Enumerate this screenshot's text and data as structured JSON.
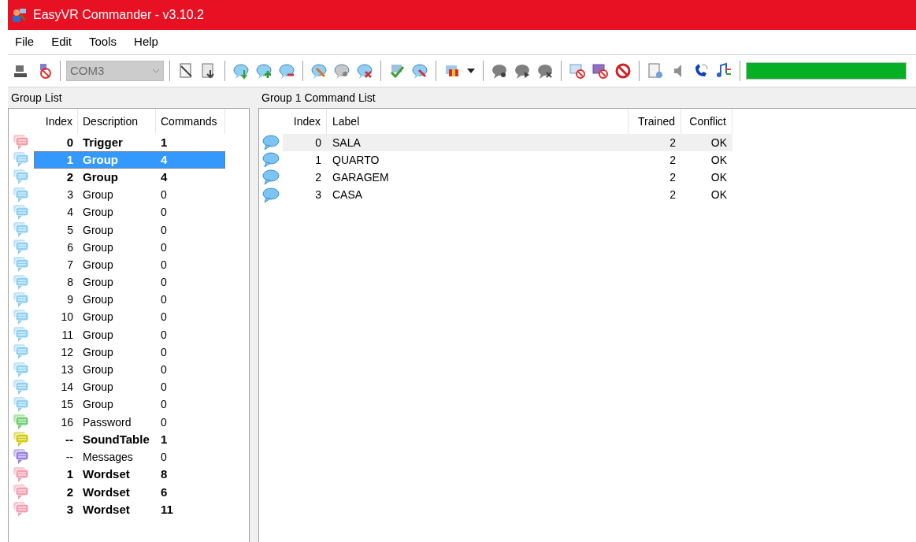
{
  "window": {
    "title": "EasyVR Commander - v3.10.2"
  },
  "menu": [
    "File",
    "Edit",
    "Tools",
    "Help"
  ],
  "toolbar": {
    "port": {
      "value": "COM3",
      "disabled": true
    },
    "status": {
      "level": 1
    }
  },
  "group_list": {
    "title": "Group List",
    "columns": [
      "Index",
      "Description",
      "Commands"
    ],
    "rows": [
      {
        "kind": "trigger",
        "index": "0",
        "description": "Trigger",
        "commands": "1",
        "bold": true,
        "selected": false
      },
      {
        "kind": "group",
        "index": "1",
        "description": "Group",
        "commands": "4",
        "bold": true,
        "selected": true
      },
      {
        "kind": "group",
        "index": "2",
        "description": "Group",
        "commands": "4",
        "bold": true,
        "selected": false
      },
      {
        "kind": "group",
        "index": "3",
        "description": "Group",
        "commands": "0",
        "bold": false,
        "selected": false
      },
      {
        "kind": "group",
        "index": "4",
        "description": "Group",
        "commands": "0",
        "bold": false,
        "selected": false
      },
      {
        "kind": "group",
        "index": "5",
        "description": "Group",
        "commands": "0",
        "bold": false,
        "selected": false
      },
      {
        "kind": "group",
        "index": "6",
        "description": "Group",
        "commands": "0",
        "bold": false,
        "selected": false
      },
      {
        "kind": "group",
        "index": "7",
        "description": "Group",
        "commands": "0",
        "bold": false,
        "selected": false
      },
      {
        "kind": "group",
        "index": "8",
        "description": "Group",
        "commands": "0",
        "bold": false,
        "selected": false
      },
      {
        "kind": "group",
        "index": "9",
        "description": "Group",
        "commands": "0",
        "bold": false,
        "selected": false
      },
      {
        "kind": "group",
        "index": "10",
        "description": "Group",
        "commands": "0",
        "bold": false,
        "selected": false
      },
      {
        "kind": "group",
        "index": "11",
        "description": "Group",
        "commands": "0",
        "bold": false,
        "selected": false
      },
      {
        "kind": "group",
        "index": "12",
        "description": "Group",
        "commands": "0",
        "bold": false,
        "selected": false
      },
      {
        "kind": "group",
        "index": "13",
        "description": "Group",
        "commands": "0",
        "bold": false,
        "selected": false
      },
      {
        "kind": "group",
        "index": "14",
        "description": "Group",
        "commands": "0",
        "bold": false,
        "selected": false
      },
      {
        "kind": "group",
        "index": "15",
        "description": "Group",
        "commands": "0",
        "bold": false,
        "selected": false
      },
      {
        "kind": "password",
        "index": "16",
        "description": "Password",
        "commands": "0",
        "bold": false,
        "selected": false
      },
      {
        "kind": "soundtable",
        "index": "--",
        "description": "SoundTable",
        "commands": "1",
        "bold": true,
        "selected": false
      },
      {
        "kind": "messages",
        "index": "--",
        "description": "Messages",
        "commands": "0",
        "bold": false,
        "selected": false
      },
      {
        "kind": "wordset",
        "index": "1",
        "description": "Wordset",
        "commands": "8",
        "bold": true,
        "selected": false
      },
      {
        "kind": "wordset",
        "index": "2",
        "description": "Wordset",
        "commands": "6",
        "bold": true,
        "selected": false
      },
      {
        "kind": "wordset",
        "index": "3",
        "description": "Wordset",
        "commands": "11",
        "bold": true,
        "selected": false
      }
    ]
  },
  "command_list": {
    "title": "Group 1 Command List",
    "columns": [
      "Index",
      "Label",
      "Trained",
      "Conflict"
    ],
    "rows": [
      {
        "index": "0",
        "label": "SALA",
        "trained": "2",
        "conflict": "OK",
        "selected": true
      },
      {
        "index": "1",
        "label": "QUARTO",
        "trained": "2",
        "conflict": "OK",
        "selected": false
      },
      {
        "index": "2",
        "label": "GARAGEM",
        "trained": "2",
        "conflict": "OK",
        "selected": false
      },
      {
        "index": "3",
        "label": "CASA",
        "trained": "2",
        "conflict": "OK",
        "selected": false
      }
    ]
  }
}
